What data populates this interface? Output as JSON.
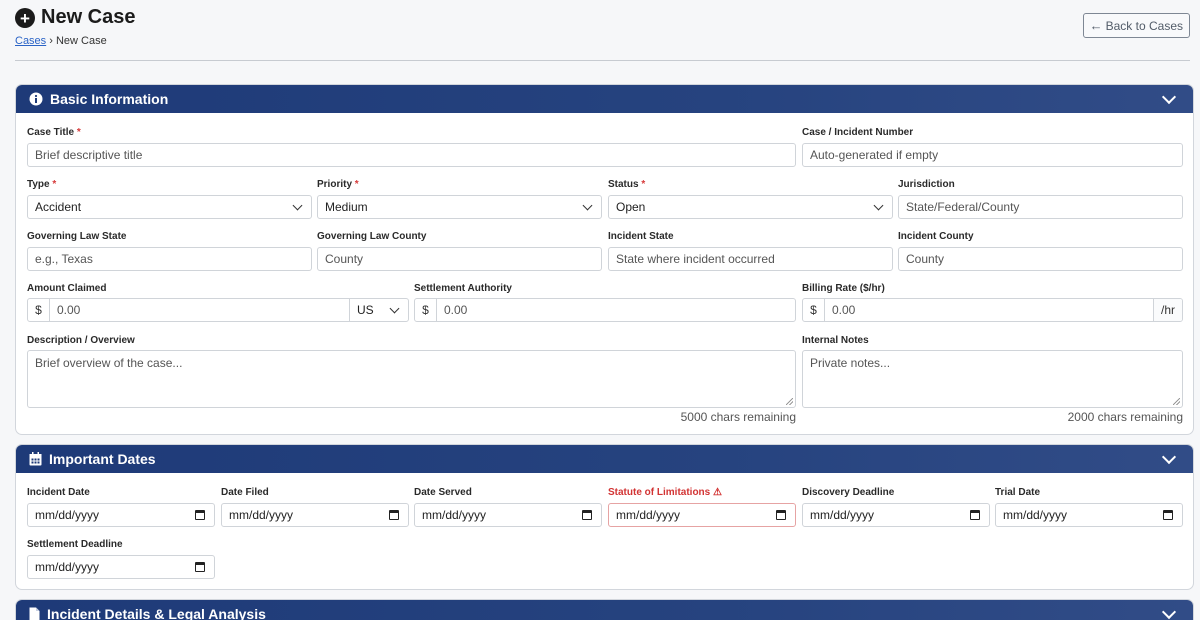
{
  "page": {
    "title": "New Case",
    "breadcrumb": {
      "link": "Cases",
      "separator": "›",
      "current": "New Case"
    },
    "back_button": "Back to Cases"
  },
  "basic": {
    "title": "Basic Information",
    "case_title": {
      "label": "Case Title",
      "placeholder": "Brief descriptive title"
    },
    "case_number": {
      "label": "Case / Incident Number",
      "placeholder": "Auto-generated if empty"
    },
    "type": {
      "label": "Type",
      "value": "Accident"
    },
    "priority": {
      "label": "Priority",
      "value": "Medium"
    },
    "status": {
      "label": "Status",
      "value": "Open"
    },
    "jurisdiction": {
      "label": "Jurisdiction",
      "placeholder": "State/Federal/County"
    },
    "gov_state": {
      "label": "Governing Law State",
      "placeholder": "e.g., Texas"
    },
    "gov_county": {
      "label": "Governing Law County",
      "placeholder": "County"
    },
    "incident_state": {
      "label": "Incident State",
      "placeholder": "State where incident occurred"
    },
    "incident_county": {
      "label": "Incident County",
      "placeholder": "County"
    },
    "amount": {
      "label": "Amount Claimed",
      "prefix": "$",
      "placeholder": "0.00",
      "currency": "US"
    },
    "settlement": {
      "label": "Settlement Authority",
      "prefix": "$",
      "placeholder": "0.00"
    },
    "billing": {
      "label": "Billing Rate ($/hr)",
      "prefix": "$",
      "placeholder": "0.00",
      "suffix": "/hr"
    },
    "description": {
      "label": "Description / Overview",
      "placeholder": "Brief overview of the case...",
      "remaining": "5000 chars remaining"
    },
    "notes": {
      "label": "Internal Notes",
      "placeholder": "Private notes...",
      "remaining": "2000 chars remaining"
    }
  },
  "dates": {
    "title": "Important Dates",
    "date_placeholder": "mm/dd/yyyy",
    "incident": "Incident Date",
    "filed": "Date Filed",
    "served": "Date Served",
    "sol": "Statute of Limitations",
    "sol_warning": "⚠",
    "discovery": "Discovery Deadline",
    "trial": "Trial Date",
    "settlement": "Settlement Deadline"
  },
  "incident": {
    "title": "Incident Details & Legal Analysis"
  },
  "colors": {
    "header_bg": "#1e3a78",
    "link": "#2a63c6",
    "required": "#d63a3a",
    "warning": "#d23333"
  }
}
